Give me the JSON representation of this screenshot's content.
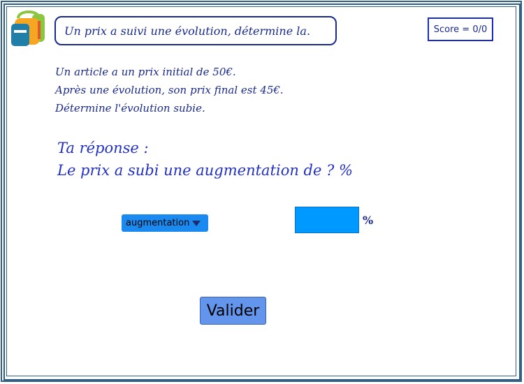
{
  "header": {
    "title": "Un prix a suivi une évolution, détermine la.",
    "score": "Score = 0/0",
    "logo_icon": "backpack-icon"
  },
  "statement": {
    "line1": "Un article a un prix initial de 50€.",
    "line2": "Après une évolution, son prix final est 45€.",
    "line3": "Détermine l'évolution subie."
  },
  "answer": {
    "label": "Ta réponse :",
    "sentence": "Le prix a subi une augmentation de ? %"
  },
  "form": {
    "dropdown_value": "augmentation",
    "input_value": "",
    "percent_sign": "%",
    "submit_label": "Valider"
  },
  "colors": {
    "text_primary": "#1a2a8c",
    "answer_text": "#2230c8",
    "dropdown_bg": "#1b8af0",
    "input_bg": "#0099ff",
    "button_bg": "#6495ed",
    "frame": "#2f5f86"
  }
}
